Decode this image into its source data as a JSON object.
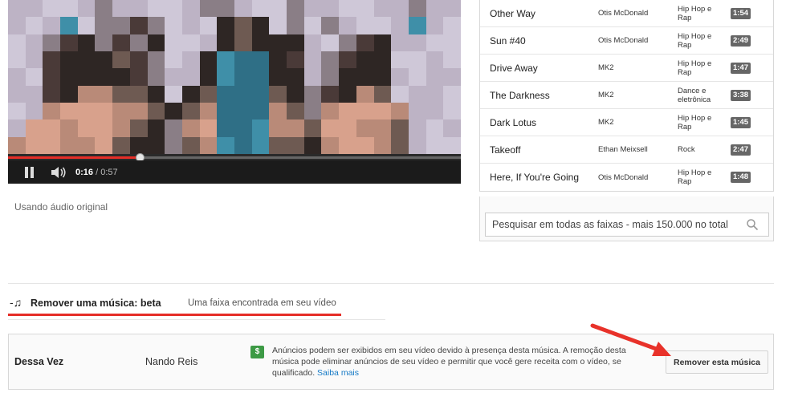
{
  "player": {
    "current_time": "0:16",
    "separator": " / ",
    "total_time": "0:57",
    "progress_fraction": 0.291,
    "audio_note": "Usando áudio original"
  },
  "tracks": [
    {
      "title": "Other Way",
      "artist": "Otis McDonald",
      "genre": "Hip Hop e Rap",
      "duration": "1:54"
    },
    {
      "title": "Sun #40",
      "artist": "Otis McDonald",
      "genre": "Hip Hop e Rap",
      "duration": "2:49"
    },
    {
      "title": "Drive Away",
      "artist": "MK2",
      "genre": "Hip Hop e Rap",
      "duration": "1:47"
    },
    {
      "title": "The Darkness",
      "artist": "MK2",
      "genre": "Dance e eletrônica",
      "duration": "3:38"
    },
    {
      "title": "Dark Lotus",
      "artist": "MK2",
      "genre": "Hip Hop e Rap",
      "duration": "1:45"
    },
    {
      "title": "Takeoff",
      "artist": "Ethan Meixsell",
      "genre": "Rock",
      "duration": "2:47"
    },
    {
      "title": "Here, If You're Going",
      "artist": "Otis McDonald",
      "genre": "Hip Hop e Rap",
      "duration": "1:48"
    }
  ],
  "search": {
    "placeholder": "Pesquisar em todas as faixas - mais 150.000 no total"
  },
  "remove_section": {
    "icon": "music-note-icon",
    "title": "Remover uma música: beta",
    "subtitle": "Uma faixa encontrada em seu vídeo",
    "found": {
      "title": "Dessa Vez",
      "artist": "Nando Reis",
      "badge_icon": "dollar-icon",
      "badge": "$",
      "message": "Anúncios podem ser exibidos em seu vídeo devido à presença desta música. A remoção desta música pode eliminar anúncios de seu vídeo e permitir que você gere receita com o vídeo, se qualificado.",
      "learn_more": "Saiba mais",
      "button": "Remover esta música"
    }
  },
  "colors": {
    "accent_red": "#e52d27",
    "link_blue": "#167ac6",
    "badge_green": "#3d9a45"
  }
}
